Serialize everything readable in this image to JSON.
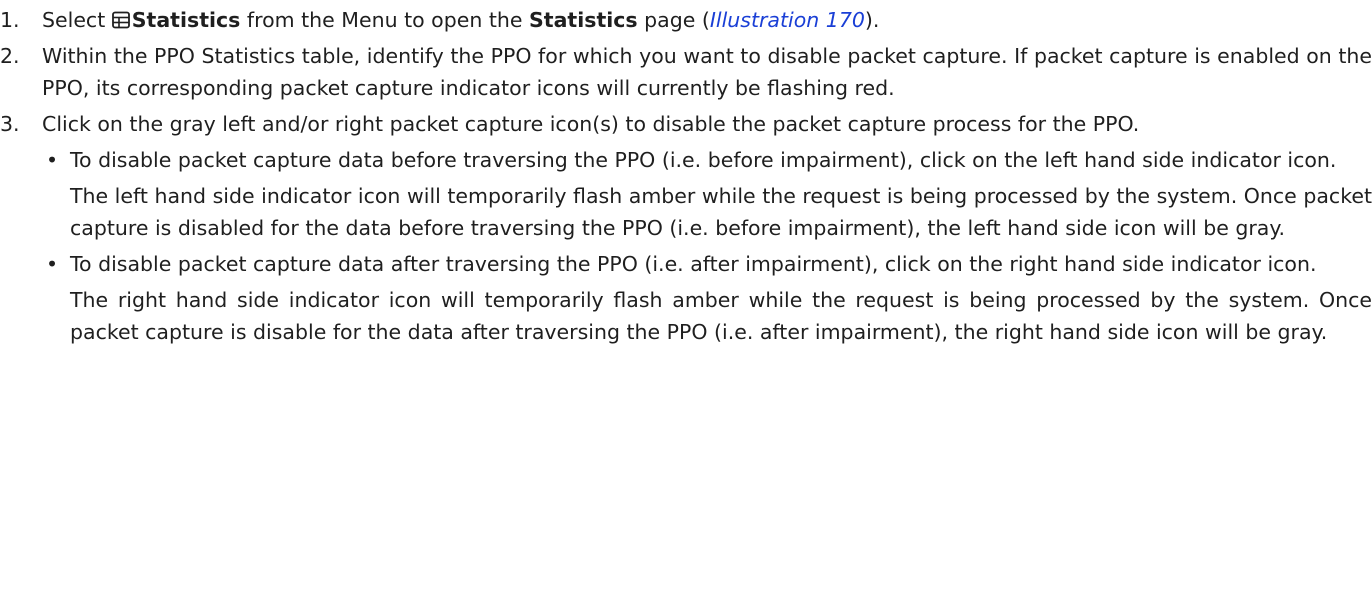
{
  "steps": [
    {
      "number": "1.",
      "pre": "Select ",
      "icon": "table-icon",
      "bold1": "Statistics",
      "mid": " from the Menu to open the ",
      "bold2": "Statistics",
      "mid2": " page (",
      "link": "Illustration 170",
      "post": ")."
    },
    {
      "number": "2.",
      "text": "Within the PPO Statistics table, identify the PPO for which you want to disable packet capture. If packet capture is enabled on the PPO, its corresponding packet capture indicator icons will currently be flashing red."
    },
    {
      "number": "3.",
      "text": "Click on the gray left and/or right packet capture icon(s) to disable the packet capture process for the PPO.",
      "bullets": [
        {
          "bullet": "•",
          "text": "To disable packet capture data before traversing the PPO (i.e. before impairment), click on the left hand side indicator icon.",
          "detail": "The left hand side indicator icon will temporarily flash amber while the request is being processed by the system. Once packet capture is disabled for the data before traversing the PPO (i.e. before impairment), the left hand side icon will be gray."
        },
        {
          "bullet": "•",
          "text": "To disable packet capture data after traversing the PPO (i.e. after impairment), click on the right hand side indicator icon.",
          "detail": "The right hand side indicator icon will temporarily flash amber while the request is being processed by the system. Once packet capture is disable for the data after traversing the PPO (i.e. after impairment), the right hand side icon will be gray."
        }
      ]
    }
  ]
}
